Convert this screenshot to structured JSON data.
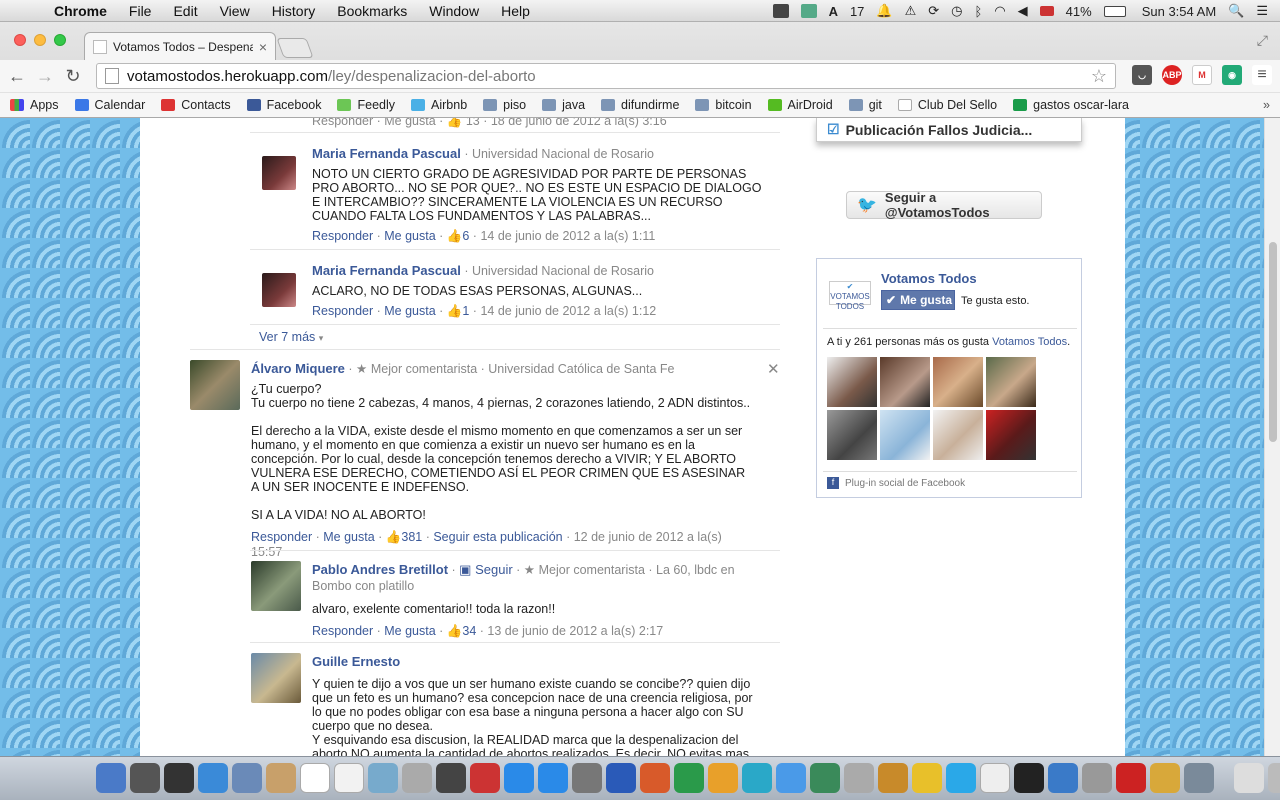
{
  "menubar": {
    "app": "Chrome",
    "items": [
      "File",
      "Edit",
      "View",
      "History",
      "Bookmarks",
      "Window",
      "Help"
    ],
    "tray": {
      "adobe_count": "17",
      "battery": "41%",
      "clock": "Sun 3:54 AM"
    }
  },
  "browser": {
    "tab_title": "Votamos Todos – Despena",
    "url_host": "votamostodos.herokuapp.com",
    "url_path": "/ley/despenalizacion-del-aborto",
    "bookmarks": [
      "Apps",
      "Calendar",
      "Contacts",
      "Facebook",
      "Feedly",
      "Airbnb",
      "piso",
      "java",
      "difundirme",
      "bitcoin",
      "AirDroid",
      "git",
      "Club Del Sello",
      "gastos oscar-lara"
    ]
  },
  "comments": {
    "top_partial": {
      "actions": "Responder · Me gusta · 👍 13 · 18 de junio de 2012 a la(s) 3:16"
    },
    "c1": {
      "name": "Maria Fernanda Pascual",
      "meta": " · Universidad Nacional de Rosario",
      "text": "NOTO UN CIERTO GRADO DE AGRESIVIDAD POR PARTE DE PERSONAS PRO ABORTO... NO SE POR QUE?.. NO ES ESTE UN ESPACIO DE DIALOGO E INTERCAMBIO?? SINCERAMENTE LA VIOLENCIA ES UN RECURSO CUANDO FALTA LOS FUNDAMENTOS Y LAS PALABRAS...",
      "likes": "6",
      "date": "14 de junio de 2012 a la(s) 1:11"
    },
    "c2": {
      "name": "Maria Fernanda Pascual",
      "meta": " · Universidad Nacional de Rosario",
      "text": "ACLARO, NO DE TODAS ESAS PERSONAS, ALGUNAS...",
      "likes": "1",
      "date": "14 de junio de 2012 a la(s) 1:12"
    },
    "see_more": "Ver 7 más",
    "main": {
      "name": "Álvaro Miquere",
      "badge": "Mejor comentarista",
      "meta": " · Universidad Católica de Santa Fe",
      "text_lines": [
        "¿Tu cuerpo?",
        "Tu cuerpo no tiene 2 cabezas, 4 manos, 4 piernas, 2 corazones latiendo, 2 ADN distintos..",
        "",
        "El derecho a la VIDA, existe desde el mismo momento en que comenzamos a ser un ser humano, y el momento en que comienza a existir un nuevo ser humano es en la concepción. Por lo cual, desde la concepción tenemos derecho a VIVIR; Y EL ABORTO VULNERA ESE DERECHO, COMETIENDO ASÍ EL PEOR CRIMEN QUE ES ASESINAR A UN SER INOCENTE E INDEFENSO.",
        "",
        "SI A LA VIDA! NO AL ABORTO!"
      ],
      "likes": "381",
      "follow": "Seguir esta publicación",
      "date": "12 de junio de 2012 a la(s) 15:57"
    },
    "r1": {
      "name": "Pablo Andres Bretillot",
      "follow": "Seguir",
      "badge": "Mejor comentarista",
      "meta": " · La 60, lbdc en Bombo con platillo",
      "text": "alvaro, exelente comentario!! toda la razon!!",
      "likes": "34",
      "date": "13 de junio de 2012 a la(s) 2:17"
    },
    "r2": {
      "name": "Guille Ernesto",
      "text": "Y quien te dijo a vos que un ser humano existe cuando se concibe?? quien dijo que un feto es un humano? esa concepcion nace de una creencia religiosa, por lo que no podes obligar con esa base a ninguna persona a hacer algo con SU cuerpo que no desea.\nY esquivando esa discusion, la REALIDAD marca que la despenalizacion del aborto NO aumenta la cantidad de abortos realizados. Es decir, NO evitas mas abortos"
    },
    "action_reply": "Responder",
    "action_like": "Me gusta"
  },
  "sidebar": {
    "top_box": "Publicación Fallos Judicia...",
    "twitter_button": "Seguir a @VotamosTodos",
    "fb_page": "Votamos Todos",
    "fb_like_button": "Me gusta",
    "fb_you_like": "Te gusta esto.",
    "fb_count_prefix": "A ti y 261 personas más os gusta ",
    "fb_count_link": "Votamos Todos",
    "fb_count_suffix": ".",
    "fb_plugin": "Plug-in social de Facebook"
  }
}
